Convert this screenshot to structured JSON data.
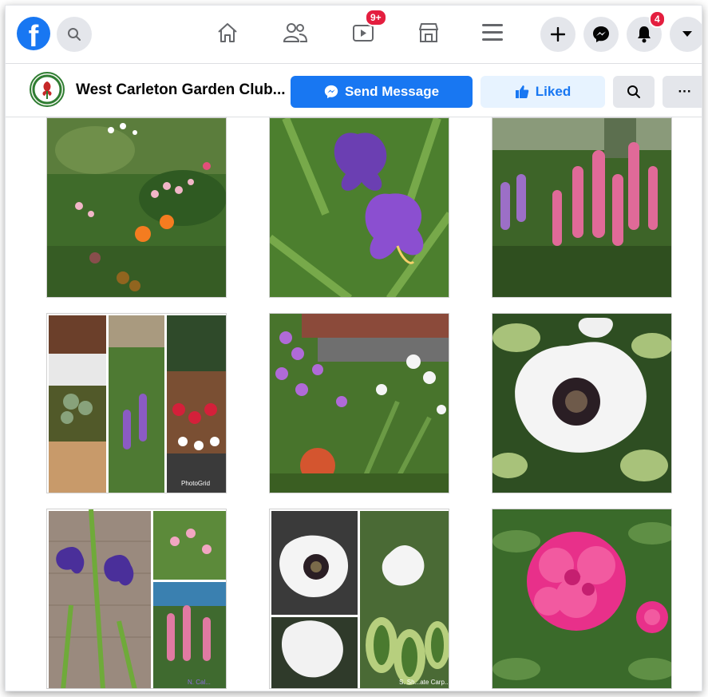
{
  "nav": {
    "logo_letter": "f",
    "watch_badge": "9+",
    "notifications_badge": "4"
  },
  "page": {
    "name": "West Carleton Garden Club...",
    "send_message_label": "Send Message",
    "liked_label": "Liked",
    "more_label": "···"
  },
  "photos": {
    "photo_4_watermark": "PhotoGrid",
    "photo_7_credit": "N. Cal...",
    "photo_8_credit": "S. Sh...ate Carp..."
  },
  "colors": {
    "facebook_blue": "#1877f2",
    "notification_red": "#e41e3f",
    "liked_bg": "#e7f3ff"
  },
  "icons": [
    "facebook-logo-icon",
    "search-icon",
    "home-icon",
    "friends-icon",
    "watch-icon",
    "marketplace-icon",
    "menu-icon",
    "plus-icon",
    "messenger-icon",
    "bell-icon",
    "caret-down-icon",
    "thumbs-up-icon"
  ]
}
